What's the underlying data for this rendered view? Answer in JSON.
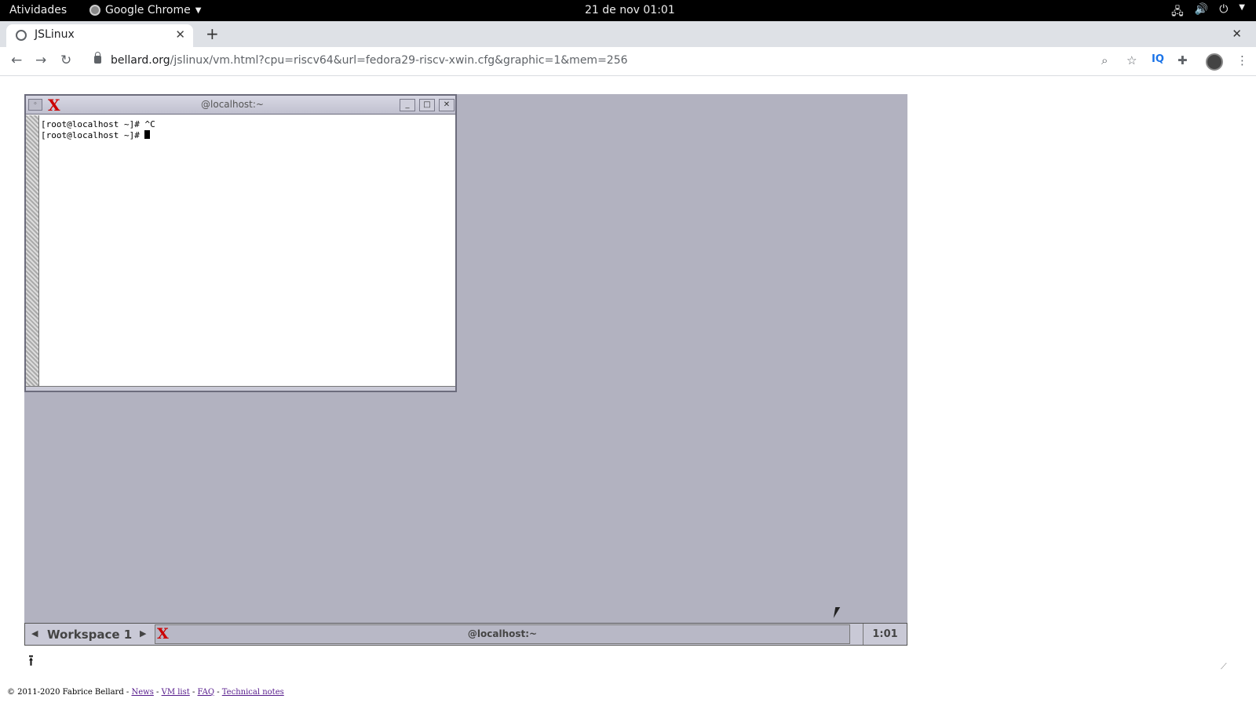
{
  "topbar": {
    "activities": "Atividades",
    "app_name": "Google Chrome",
    "clock": "21 de nov  01:01"
  },
  "browser": {
    "tab_title": "JSLinux",
    "url_host": "bellard.org",
    "url_path": "/jslinux/vm.html?cpu=riscv64&url=fedora29-riscv-xwin.cfg&graphic=1&mem=256"
  },
  "xterm": {
    "title": "@localhost:~",
    "line1": "[root@localhost ~]# ^C",
    "line2": "[root@localhost ~]# "
  },
  "taskbar": {
    "workspace": "Workspace 1",
    "task_title": "@localhost:~",
    "clock": "1:01"
  },
  "footer": {
    "copyright": "© 2011-2020 Fabrice Bellard - ",
    "links": [
      "News",
      "VM list",
      "FAQ",
      "Technical notes"
    ]
  }
}
